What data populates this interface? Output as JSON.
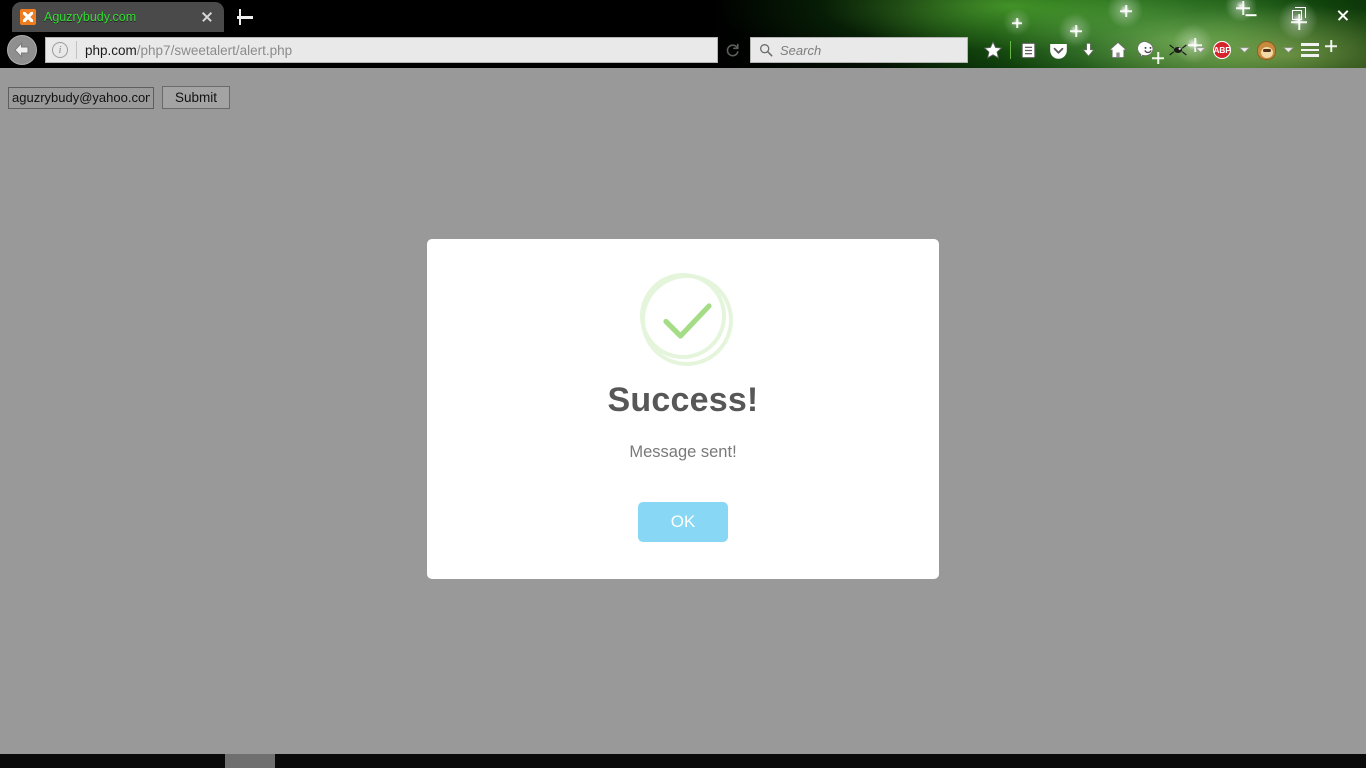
{
  "browser": {
    "tab": {
      "title": "Aguzrybudy.com",
      "favicon": "xampp-icon",
      "close_icon": "close-icon"
    },
    "new_tab_icon": "plus-icon",
    "window_controls": {
      "minimize": "minimize-icon",
      "maximize": "restore-icon",
      "close": "close-icon"
    },
    "nav": {
      "back_icon": "back-arrow-icon",
      "reload_icon": "reload-icon",
      "identity_icon": "info-circle-icon",
      "url_host": "php.com",
      "url_path": "/php7/sweetalert/alert.php",
      "url_full": "php.com/php7/sweetalert/alert.php"
    },
    "search": {
      "icon": "search-icon",
      "placeholder": "Search",
      "value": ""
    },
    "toolbar_icons": [
      {
        "name": "bookmark-star-icon",
        "label": "Bookmark this page"
      },
      {
        "name": "reader-list-icon",
        "label": "Reading list"
      },
      {
        "name": "pocket-icon",
        "label": "Save to Pocket"
      },
      {
        "name": "downloads-icon",
        "label": "Downloads"
      },
      {
        "name": "home-icon",
        "label": "Home"
      },
      {
        "name": "smiley-icon",
        "label": "Feedback"
      },
      {
        "name": "extension-dark-icon",
        "label": "Extension"
      },
      {
        "name": "abp-icon",
        "label": "ABP"
      },
      {
        "name": "monkey-extension-icon",
        "label": "Greasemonkey"
      },
      {
        "name": "menu-hamburger-icon",
        "label": "Open menu"
      }
    ],
    "abp_label": "ABP"
  },
  "page_form": {
    "email_value": "aguzrybudy@yahoo.com",
    "email_placeholder": "",
    "submit_label": "Submit"
  },
  "modal": {
    "icon": "success-check-icon",
    "title": "Success!",
    "text": "Message sent!",
    "confirm_label": "OK",
    "colors": {
      "ring": "#e5f5dc",
      "check": "#a5dc86",
      "button": "#88d7f4",
      "title": "#575757",
      "text": "#797979"
    }
  },
  "theme": {
    "page_background": "#999999",
    "persona": "green-starburst-swirl",
    "tab_title_color": "#33dd33"
  }
}
